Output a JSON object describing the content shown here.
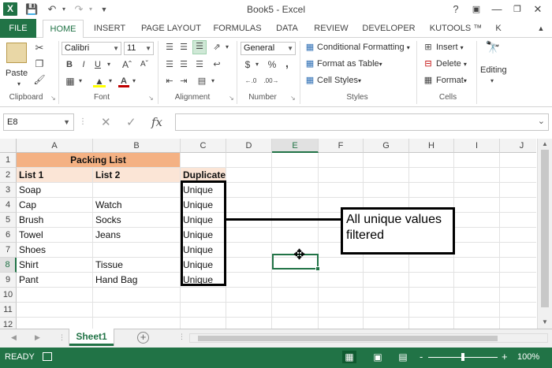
{
  "app": {
    "title": "Book5 - Excel",
    "logo": "X",
    "accent": "#217346"
  },
  "qat": {
    "save_icon": "save-icon",
    "undo_icon": "undo-icon",
    "redo_icon": "redo-icon",
    "customize_icon": "customize-qat-icon"
  },
  "window": {
    "help": "?",
    "ribbon_options": "ribbon-display-options-icon",
    "minimize": "minimize-icon",
    "restore": "restore-icon",
    "close": "close-icon"
  },
  "tabs": [
    "FILE",
    "HOME",
    "INSERT",
    "PAGE LAYOUT",
    "FORMULAS",
    "DATA",
    "REVIEW",
    "DEVELOPER",
    "KUTOOLS ™",
    "K"
  ],
  "ribbon": {
    "clipboard": {
      "label": "Clipboard",
      "paste": "Paste"
    },
    "font": {
      "label": "Font",
      "name": "Calibri",
      "size": "11"
    },
    "alignment": {
      "label": "Alignment"
    },
    "number": {
      "label": "Number",
      "format": "General",
      "dollar": "$",
      "percent": "%",
      "comma": ","
    },
    "styles": {
      "label": "Styles",
      "conditional": "Conditional Formatting",
      "format_table": "Format as Table",
      "cell_styles": "Cell Styles"
    },
    "cells": {
      "label": "Cells",
      "insert": "Insert",
      "delete": "Delete",
      "format": "Format"
    },
    "editing": {
      "label": "Editing"
    }
  },
  "formula_bar": {
    "name_box": "E8",
    "fx": "fx",
    "value": ""
  },
  "columns": [
    "A",
    "B",
    "C",
    "D",
    "E",
    "F",
    "G",
    "H",
    "I",
    "J"
  ],
  "selected_column": "E",
  "rows": [
    "1",
    "2",
    "3",
    "4",
    "5",
    "6",
    "7",
    "8",
    "9",
    "10",
    "11",
    "12"
  ],
  "selected_row": "8",
  "sheet": {
    "title": "Packing List",
    "headers": [
      "List 1",
      "List 2",
      "Duplicate"
    ],
    "data": [
      [
        "Soap",
        "",
        "Unique"
      ],
      [
        "Cap",
        "Watch",
        "Unique"
      ],
      [
        "Brush",
        "Socks",
        "Unique"
      ],
      [
        "Towel",
        "Jeans",
        "Unique"
      ],
      [
        "Shoes",
        "",
        "Unique"
      ],
      [
        "Shirt",
        "Tissue",
        "Unique"
      ],
      [
        "Pant",
        "Hand Bag",
        "Unique"
      ]
    ]
  },
  "annotation": {
    "text": "All unique values filtered"
  },
  "sheet_tabs": [
    "Sheet1"
  ],
  "status": {
    "ready": "READY",
    "zoom": "100%",
    "zoom_minus": "-",
    "zoom_plus": "+"
  }
}
